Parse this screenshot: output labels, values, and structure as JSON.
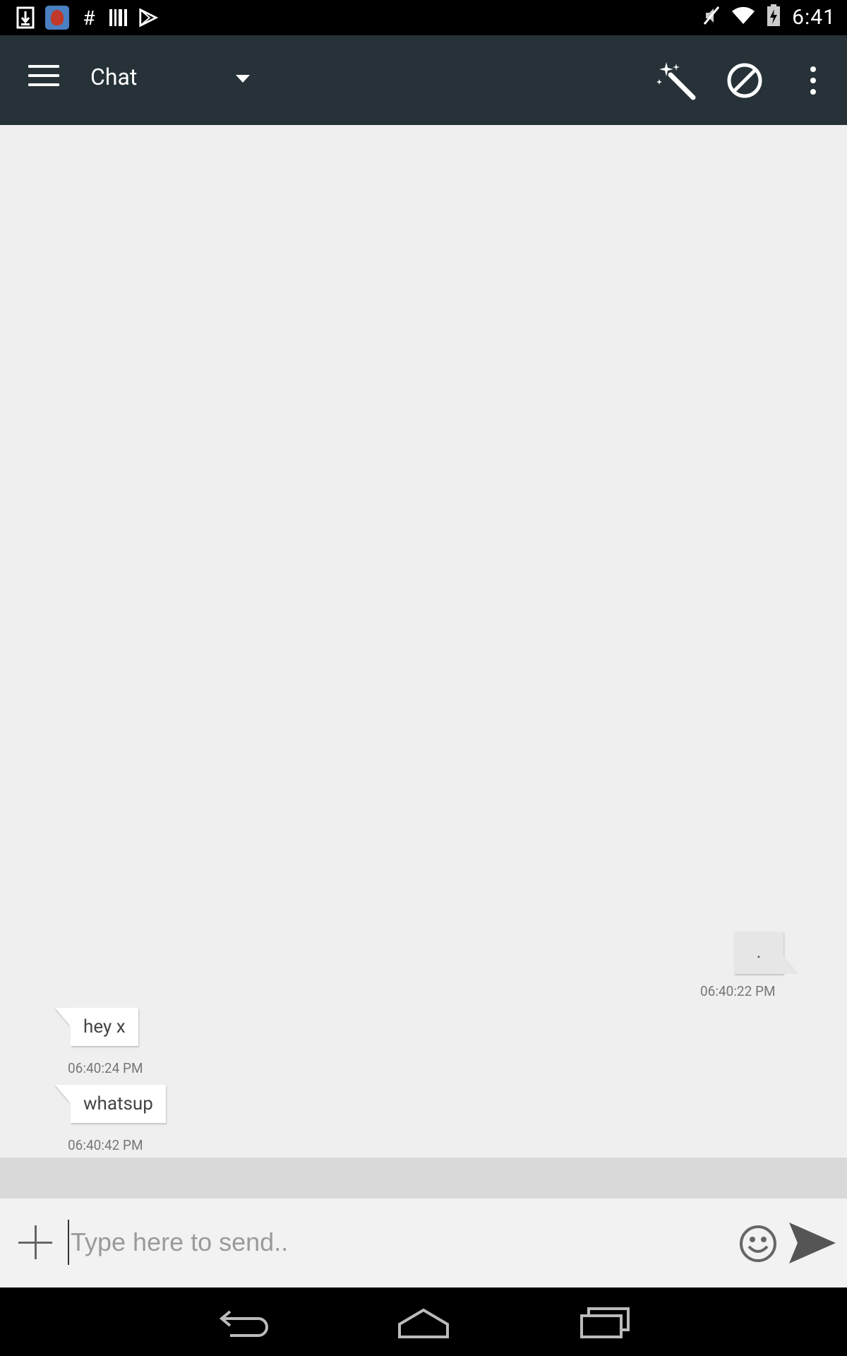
{
  "status_bar": {
    "time": "6:41",
    "left_icons": [
      "download-icon",
      "app-notification-icon",
      "hashtag-icon",
      "barcode-icon",
      "play-store-icon"
    ],
    "right_icons": [
      "mute-icon",
      "wifi-icon",
      "battery-icon"
    ]
  },
  "action_bar": {
    "title": "Chat",
    "icons": [
      "menu-icon",
      "dropdown-caret-icon",
      "magic-wand-icon",
      "block-icon",
      "overflow-menu-icon"
    ],
    "background": "#263238"
  },
  "messages": [
    {
      "direction": "outgoing",
      "text": ".",
      "time": "06:40:22 PM"
    },
    {
      "direction": "incoming",
      "text": "hey x",
      "time": "06:40:24 PM"
    },
    {
      "direction": "incoming",
      "text": "whatsup",
      "time": "06:40:42 PM"
    }
  ],
  "input_bar": {
    "placeholder": "Type here to send..",
    "value": "",
    "icons": [
      "add-icon",
      "emoji-icon",
      "send-icon"
    ]
  },
  "nav_bar": {
    "icons": [
      "back-icon",
      "home-icon",
      "recents-icon"
    ]
  }
}
